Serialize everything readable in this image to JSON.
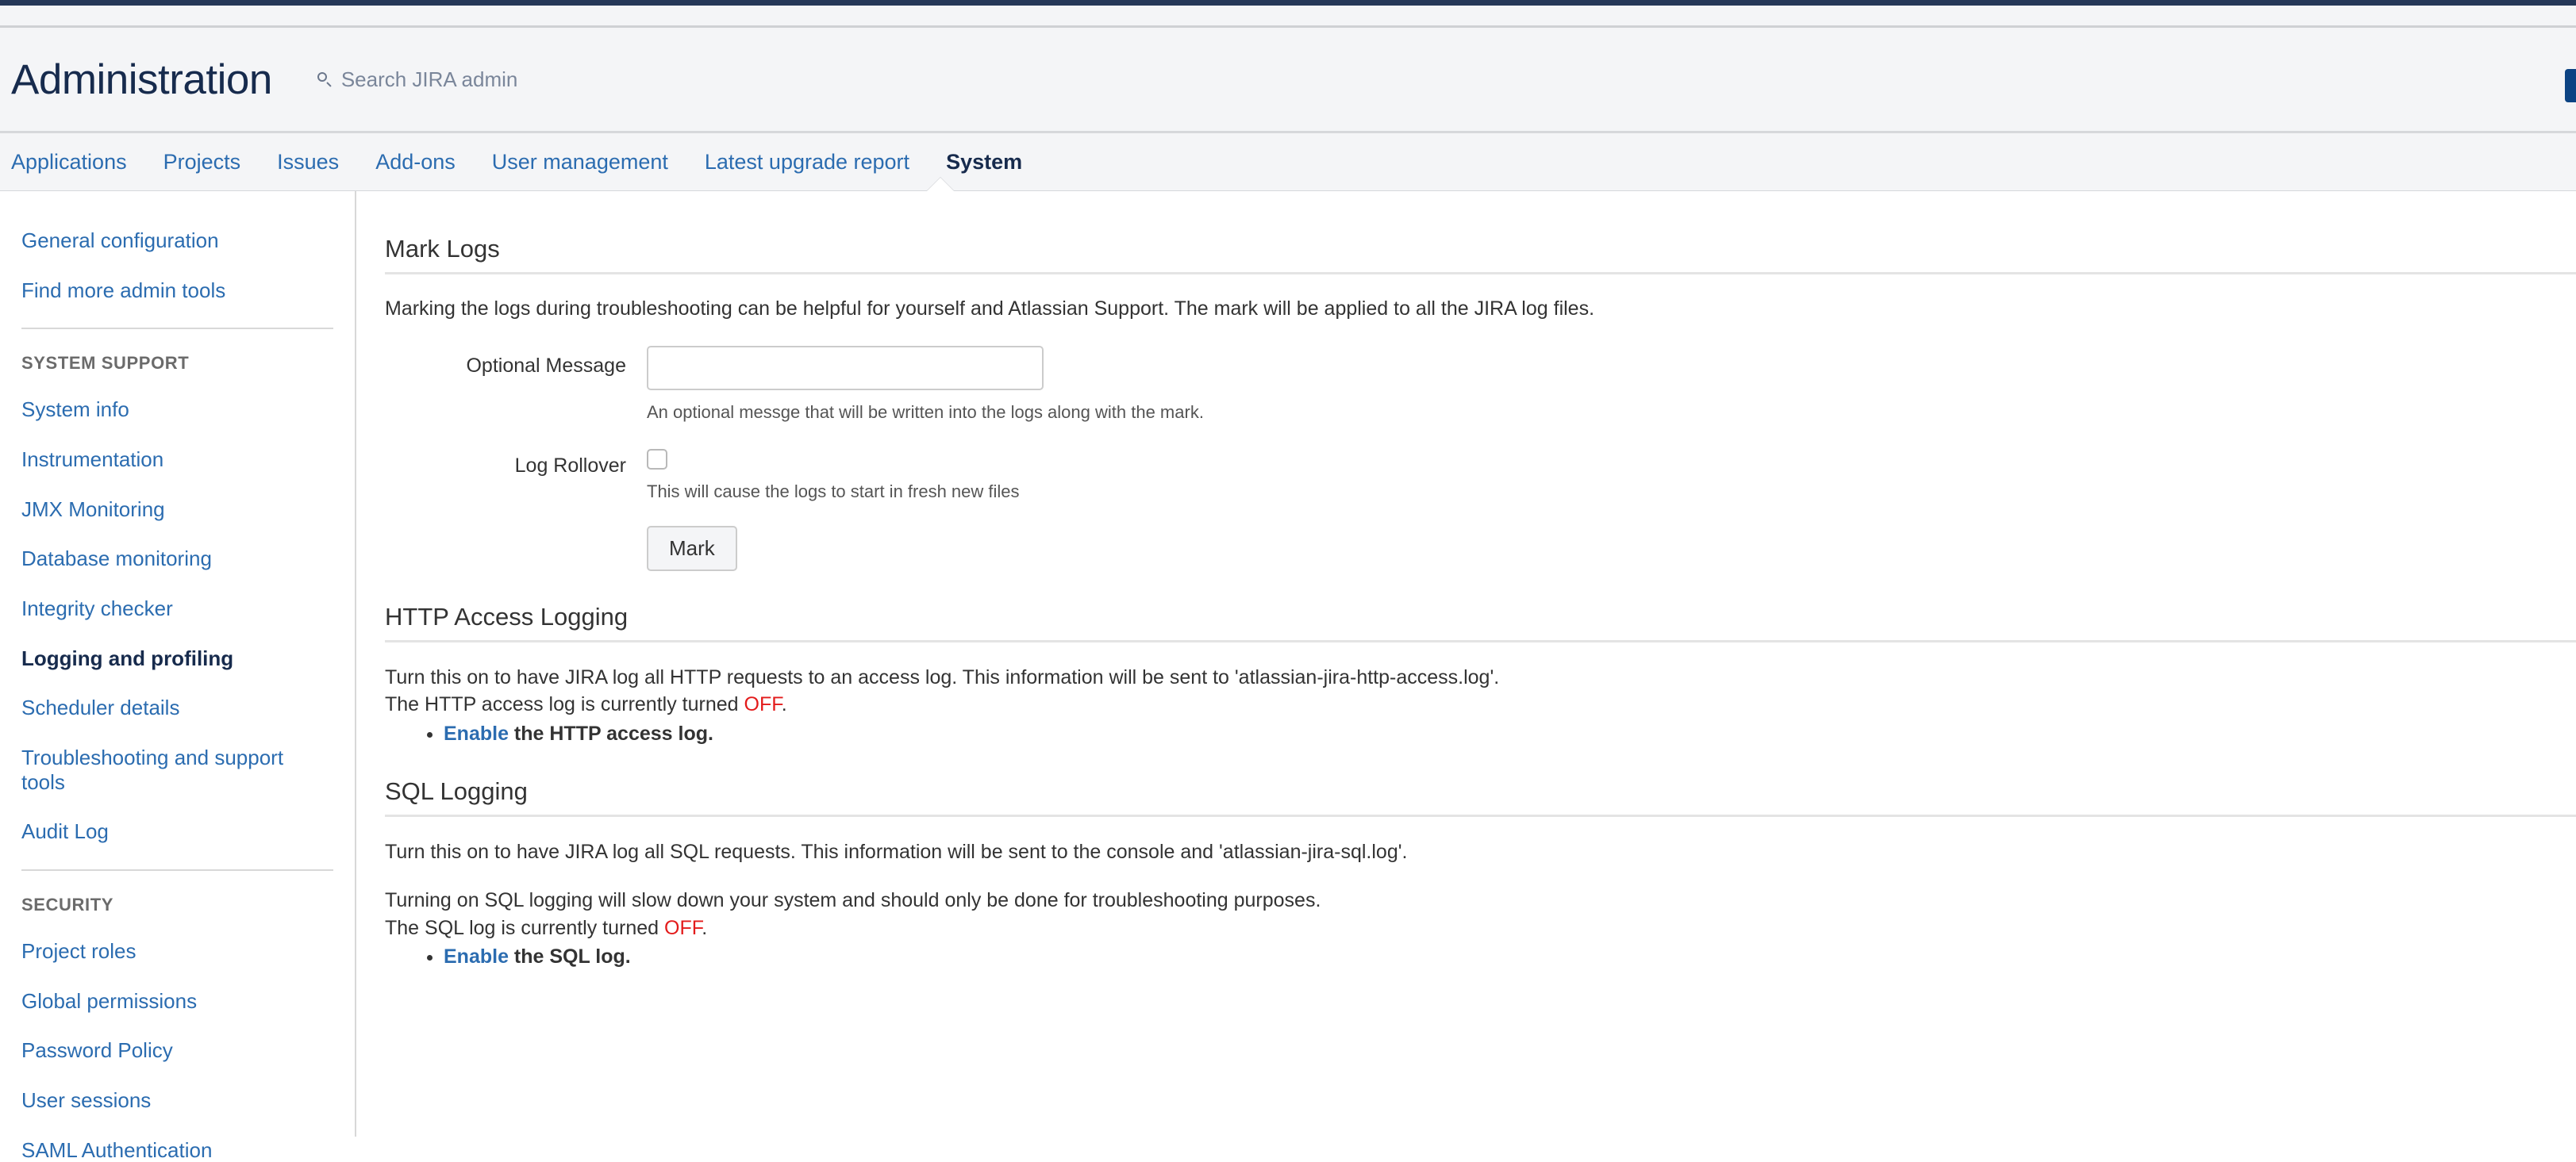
{
  "header": {
    "title": "Administration",
    "search_placeholder": "Search JIRA admin",
    "search_icon": "search-icon"
  },
  "nav": {
    "tabs": [
      {
        "label": "Applications",
        "active": false
      },
      {
        "label": "Projects",
        "active": false
      },
      {
        "label": "Issues",
        "active": false
      },
      {
        "label": "Add-ons",
        "active": false
      },
      {
        "label": "User management",
        "active": false
      },
      {
        "label": "Latest upgrade report",
        "active": false
      },
      {
        "label": "System",
        "active": true
      }
    ]
  },
  "sidebar": {
    "top_links": [
      {
        "label": "General configuration"
      },
      {
        "label": "Find more admin tools"
      }
    ],
    "groups": [
      {
        "heading": "SYSTEM SUPPORT",
        "items": [
          {
            "label": "System info",
            "active": false
          },
          {
            "label": "Instrumentation",
            "active": false
          },
          {
            "label": "JMX Monitoring",
            "active": false
          },
          {
            "label": "Database monitoring",
            "active": false
          },
          {
            "label": "Integrity checker",
            "active": false
          },
          {
            "label": "Logging and profiling",
            "active": true
          },
          {
            "label": "Scheduler details",
            "active": false
          },
          {
            "label": "Troubleshooting and support tools",
            "active": false
          },
          {
            "label": "Audit Log",
            "active": false
          }
        ]
      },
      {
        "heading": "SECURITY",
        "items": [
          {
            "label": "Project roles",
            "active": false
          },
          {
            "label": "Global permissions",
            "active": false
          },
          {
            "label": "Password Policy",
            "active": false
          },
          {
            "label": "User sessions",
            "active": false
          },
          {
            "label": "SAML Authentication",
            "active": false
          }
        ]
      }
    ]
  },
  "main": {
    "mark_logs": {
      "title": "Mark Logs",
      "description": "Marking the logs during troubleshooting can be helpful for yourself and Atlassian Support. The mark will be applied to all the JIRA log files.",
      "optional_message_label": "Optional Message",
      "optional_message_value": "",
      "optional_message_help": "An optional messge that will be written into the logs along with the mark.",
      "log_rollover_label": "Log Rollover",
      "log_rollover_checked": false,
      "log_rollover_help": "This will cause the logs to start in fresh new files",
      "mark_button": "Mark"
    },
    "http_access_logging": {
      "title": "HTTP Access Logging",
      "description": "Turn this on to have JIRA log all HTTP requests to an access log. This information will be sent to 'atlassian-jira-http-access.log'.",
      "status_prefix": "The HTTP access log is currently turned ",
      "status_value": "OFF",
      "status_suffix": ".",
      "enable_link": "Enable",
      "enable_suffix": " the HTTP access log."
    },
    "sql_logging": {
      "title": "SQL Logging",
      "description": "Turn this on to have JIRA log all SQL requests. This information will be sent to the console and 'atlassian-jira-sql.log'.",
      "warning": "Turning on SQL logging will slow down your system and should only be done for troubleshooting purposes.",
      "status_prefix": "The SQL log is currently turned ",
      "status_value": "OFF",
      "status_suffix": ".",
      "enable_link": "Enable",
      "enable_suffix": " the SQL log."
    }
  },
  "colors": {
    "link": "#2b6cb0",
    "off_status": "#e31b1b",
    "top_strip": "#253858",
    "header_bg": "#f4f5f7"
  }
}
